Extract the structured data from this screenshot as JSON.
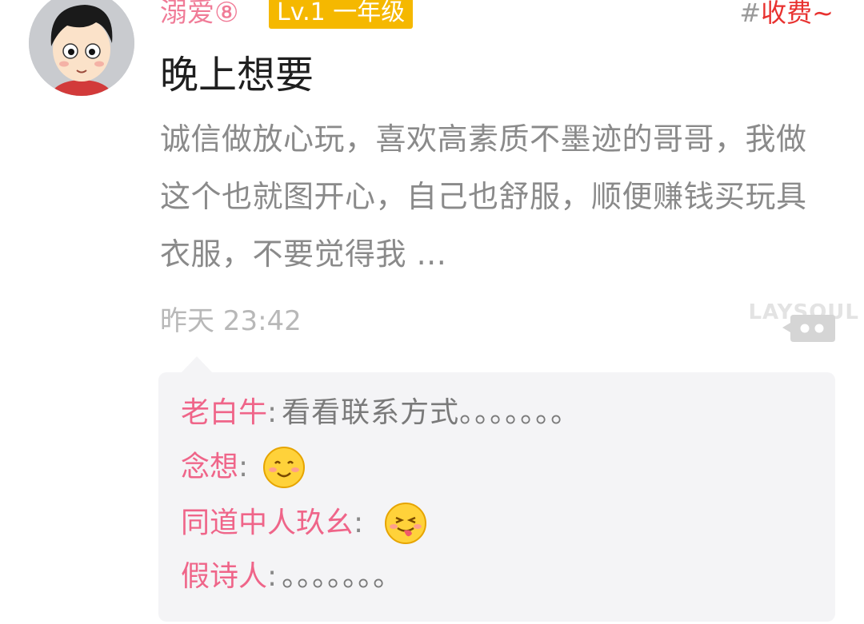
{
  "post": {
    "username": "溺爱⑧",
    "level_badge": "Lv.1 一年级",
    "topic_hash": "#",
    "topic_label": "收费~",
    "title": "晚上想要",
    "body": "诚信做放心玩，喜欢高素质不墨迹的哥哥，我做这个也就图开心，自己也舒服，顺便赚钱买玩具衣服，不要觉得我 ...",
    "timestamp": "昨天 23:42",
    "watermark": "LAYSOUL",
    "comment_icon": "comment-bubble-icon",
    "avatar_icon": "cartoon-boy-avatar"
  },
  "comments": [
    {
      "author": "老白牛",
      "colon": ":",
      "text": "看看联系方式。。。。。。。"
    },
    {
      "author": "念想",
      "colon": ":",
      "emoji": "smiling-face-emoji"
    },
    {
      "author": "同道中人玖幺",
      "colon": ":",
      "emoji": "tongue-out-face-emoji"
    },
    {
      "author": "假诗人",
      "colon": ":",
      "text": "。。。。。。。"
    }
  ],
  "colors": {
    "username": "#f07b97",
    "level_badge_bg": "#f5b800",
    "topic_tag": "#e8312f",
    "comment_author": "#ef6589",
    "comments_bg": "#f4f4f6"
  }
}
